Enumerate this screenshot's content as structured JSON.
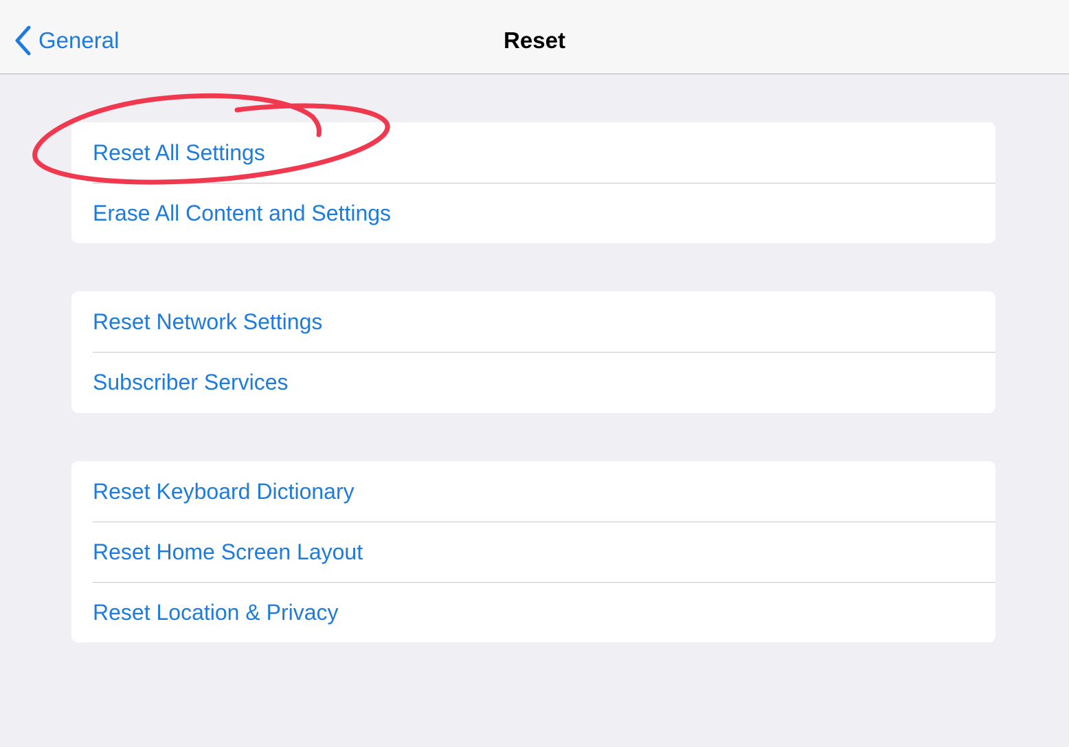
{
  "navbar": {
    "back_label": "General",
    "title": "Reset"
  },
  "groups": [
    {
      "items": [
        {
          "label": "Reset All Settings"
        },
        {
          "label": "Erase All Content and Settings"
        }
      ]
    },
    {
      "items": [
        {
          "label": "Reset Network Settings"
        },
        {
          "label": "Subscriber Services"
        }
      ]
    },
    {
      "items": [
        {
          "label": "Reset Keyboard Dictionary"
        },
        {
          "label": "Reset Home Screen Layout"
        },
        {
          "label": "Reset Location & Privacy"
        }
      ]
    }
  ],
  "colors": {
    "accent": "#1d7bdf",
    "annotation": "#f0384f",
    "background": "#efeff4"
  }
}
